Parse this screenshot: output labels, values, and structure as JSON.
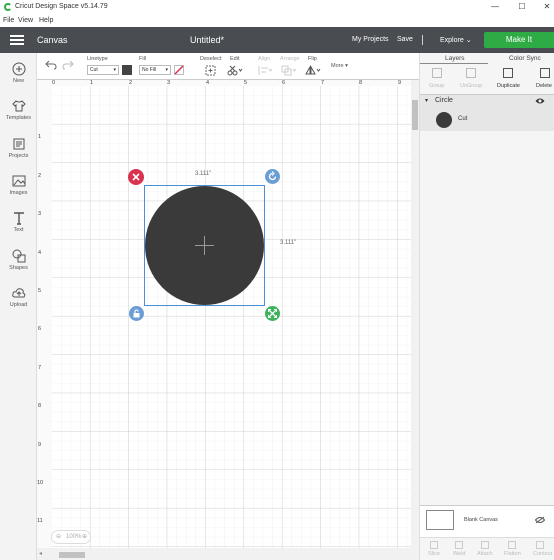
{
  "app": {
    "title": "Cricut Design Space  v5.14.79",
    "window_controls": [
      "—",
      "☐",
      "✕"
    ]
  },
  "menu": [
    "File",
    "View",
    "Help"
  ],
  "header": {
    "section": "Canvas",
    "document": "Untitled*",
    "my_projects": "My Projects",
    "save": "Save",
    "separator": "|",
    "explore": "Explore",
    "make_it": "Make It"
  },
  "sidebar": [
    {
      "label": "New",
      "icon": "plus-icon"
    },
    {
      "label": "Templates",
      "icon": "shirt-icon"
    },
    {
      "label": "Projects",
      "icon": "folder-icon"
    },
    {
      "label": "Images",
      "icon": "image-icon"
    },
    {
      "label": "Text",
      "icon": "text-icon"
    },
    {
      "label": "Shapes",
      "icon": "shapes-icon"
    },
    {
      "label": "Upload",
      "icon": "cloud-upload-icon"
    }
  ],
  "toolbar": {
    "linetype_label": "Linetype",
    "linetype_value": "Cut",
    "fill_label": "Fill",
    "fill_value": "No Fill",
    "deselect": "Deselect",
    "edit": "Edit",
    "align": "Align",
    "arrange": "Arrange",
    "flip": "Flip",
    "more": "More"
  },
  "canvas": {
    "ruler_top": [
      "0",
      "1",
      "2",
      "3",
      "4",
      "5",
      "6",
      "7",
      "8",
      "9"
    ],
    "ruler_left": [
      "1",
      "2",
      "3",
      "4",
      "5",
      "6",
      "7",
      "8",
      "9",
      "10",
      "11"
    ],
    "width_label": "3.111\"",
    "height_label": "3.111\"",
    "zoom": "100%",
    "shape_color": "#3a3a3a",
    "selection_color": "#4a90d9",
    "handle_delete_color": "#d9334f",
    "handle_rotate_color": "#6b9fd4",
    "handle_lock_color": "#6b9fd4",
    "handle_scale_color": "#3db35c"
  },
  "rpanel": {
    "tab_layers": "Layers",
    "tab_color_sync": "Color Sync",
    "actions": [
      "Group",
      "UnGroup",
      "Duplicate",
      "Delete"
    ],
    "layer_group": "Circle",
    "layer_item": "Cut",
    "blank_canvas": "Blank Canvas",
    "bottom_actions": [
      "Slice",
      "Weld",
      "Attach",
      "Flatten",
      "Contour"
    ]
  },
  "colors": {
    "header_bg": "#494c51",
    "make_it": "#2eab44"
  }
}
